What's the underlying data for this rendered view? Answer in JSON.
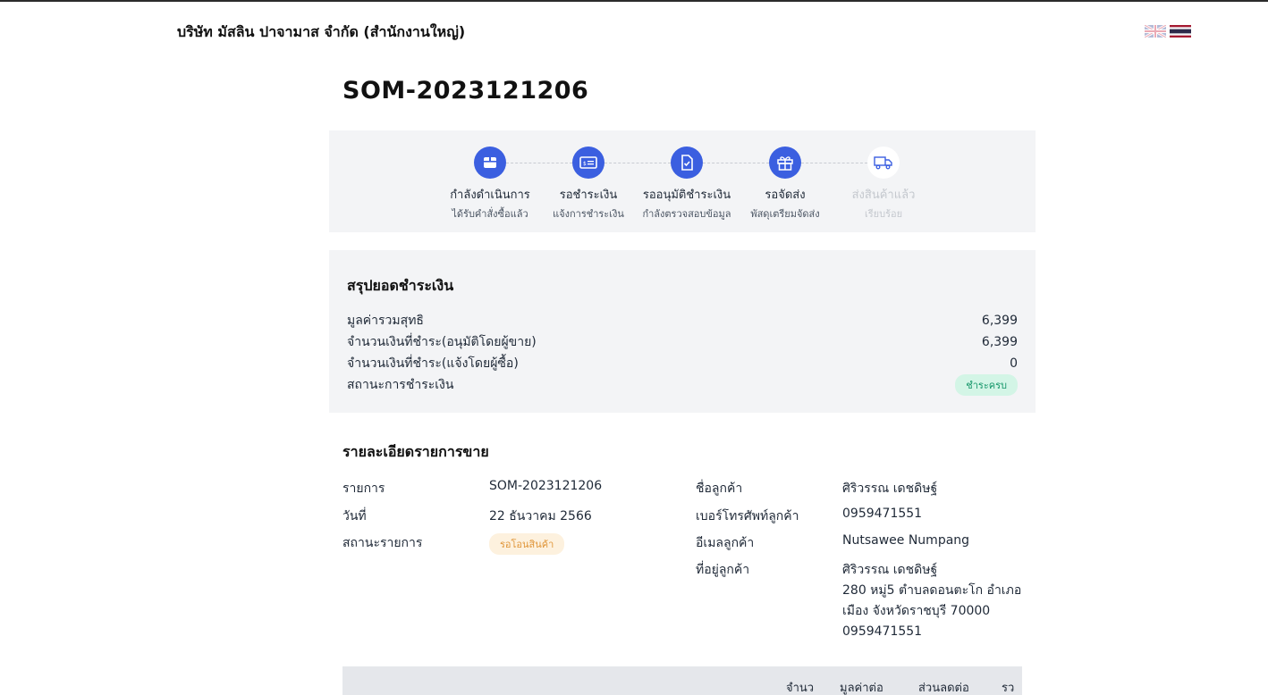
{
  "header": {
    "company_name": "บริษัท มัสลิน ปาจามาส จำกัด (สำนักงานใหญ่)",
    "languages": [
      "EN",
      "TH"
    ]
  },
  "order": {
    "number": "SOM-2023121206"
  },
  "progress": {
    "steps": [
      {
        "title": "กำลังดำเนินการ",
        "subtitle": "ได้รับคำสั่งซื้อแล้ว",
        "icon": "box-icon",
        "active": true
      },
      {
        "title": "รอชำระเงิน",
        "subtitle": "แจ้งการชำระเงิน",
        "icon": "payment-card-icon",
        "active": true
      },
      {
        "title": "รออนุมัติชำระเงิน",
        "subtitle": "กำลังตรวจสอบข้อมูล",
        "icon": "document-check-icon",
        "active": true
      },
      {
        "title": "รอจัดส่ง",
        "subtitle": "พัสดุเตรียมจัดส่ง",
        "icon": "gift-box-icon",
        "active": true
      },
      {
        "title": "ส่งสินค้าแล้ว",
        "subtitle": "เรียบร้อย",
        "icon": "truck-icon",
        "active": false
      }
    ]
  },
  "payment_summary": {
    "title": "สรุปยอดชำระเงิน",
    "rows": [
      {
        "label": "มูลค่ารวมสุทธิ",
        "value": "6,399"
      },
      {
        "label": "จำนวนเงินที่ชำระ(อนุมัติโดยผู้ขาย)",
        "value": "6,399"
      },
      {
        "label": "จำนวนเงินที่ชำระ(แจ้งโดยผู้ซื้อ)",
        "value": "0"
      }
    ],
    "status_label": "สถานะการชำระเงิน",
    "status_badge": "ชำระครบ"
  },
  "sale_details": {
    "title": "รายละเอียดรายการขาย",
    "order_label": "รายการ",
    "order_value": "SOM-2023121206",
    "date_label": "วันที่",
    "date_value": "22 ธันวาคม 2566",
    "status_label": "สถานะรายการ",
    "status_badge": "รอโอนสินค้า",
    "customer_name_label": "ชื่อลูกค้า",
    "customer_name": "ศิริวรรณ เดชดิษฐ์",
    "phone_label": "เบอร์โทรศัพท์ลูกค้า",
    "phone": "0959471551",
    "email_label": "อีเมลลูกค้า",
    "email": "Nutsawee Numpang",
    "address_label": "ที่อยู่ลูกค้า",
    "address_lines": [
      "ศิริวรรณ เดชดิษฐ์",
      "280 หมู่5 ตำบลดอนตะโก อำเภอ",
      "เมือง จังหวัดราชบุรี 70000",
      "0959471551"
    ]
  },
  "items_table": {
    "columns": [
      "จำนว",
      "มูลค่าต่อ",
      "ส่วนลดต่อ",
      "รว"
    ]
  },
  "colors": {
    "accent": "#3b5fe0",
    "panel_bg": "#f3f4f6",
    "paid_badge_bg": "#d3f5e6",
    "paid_badge_text": "#16976a",
    "pending_badge_bg": "#fdf1de",
    "pending_badge_text": "#e0963a"
  }
}
